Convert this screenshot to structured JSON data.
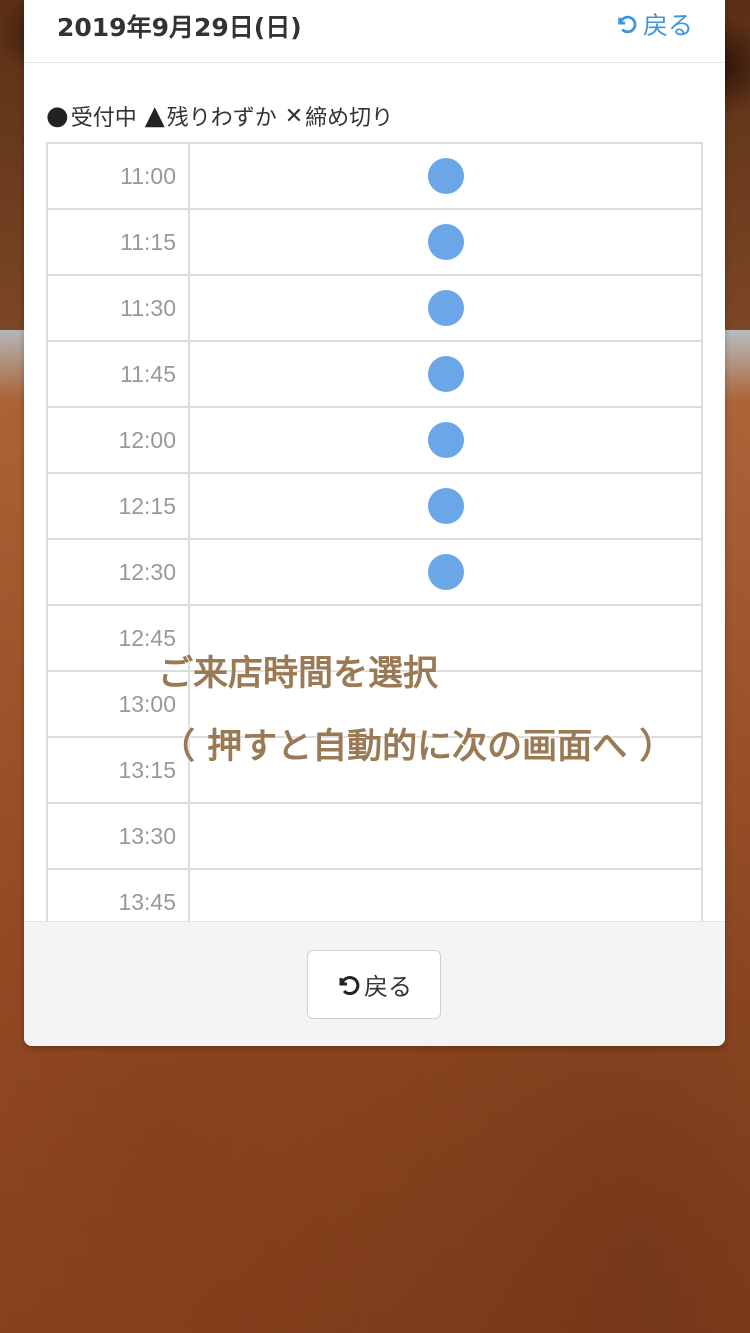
{
  "header": {
    "date": "2019年9月29日(日)",
    "back_label": "戻る"
  },
  "legend": {
    "available": "受付中",
    "few_left": "残りわずか",
    "closed": "締め切り",
    "available_symbol": "●",
    "few_left_symbol": "▲",
    "closed_symbol": "✕"
  },
  "slots": [
    {
      "time": "11:00",
      "status": "available"
    },
    {
      "time": "11:15",
      "status": "available"
    },
    {
      "time": "11:30",
      "status": "available"
    },
    {
      "time": "11:45",
      "status": "available"
    },
    {
      "time": "12:00",
      "status": "available"
    },
    {
      "time": "12:15",
      "status": "available"
    },
    {
      "time": "12:30",
      "status": "available"
    },
    {
      "time": "12:45",
      "status": ""
    },
    {
      "time": "13:00",
      "status": ""
    },
    {
      "time": "13:15",
      "status": ""
    },
    {
      "time": "13:30",
      "status": ""
    },
    {
      "time": "13:45",
      "status": ""
    }
  ],
  "footer": {
    "back_label": "戻る"
  },
  "overlay": {
    "line1": "ご来店時間を選択",
    "line2": "（ 押すと自動的に次の画面へ ）"
  },
  "colors": {
    "accent": "#3c96de",
    "available_dot": "#6aa6e8",
    "overlay_text": "#9a7a55"
  }
}
